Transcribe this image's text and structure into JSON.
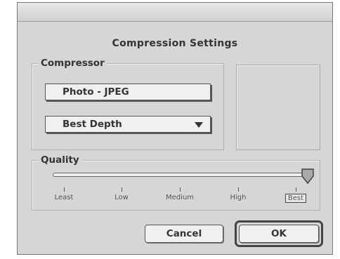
{
  "dialog": {
    "title": "Compression Settings"
  },
  "compressor": {
    "group_label": "Compressor",
    "codec": "Photo - JPEG",
    "depth": "Best Depth"
  },
  "quality": {
    "group_label": "Quality",
    "ticks": [
      "Least",
      "Low",
      "Medium",
      "High",
      "Best"
    ],
    "selected": "Best",
    "level": 1.0
  },
  "buttons": {
    "cancel": "Cancel",
    "ok": "OK"
  }
}
